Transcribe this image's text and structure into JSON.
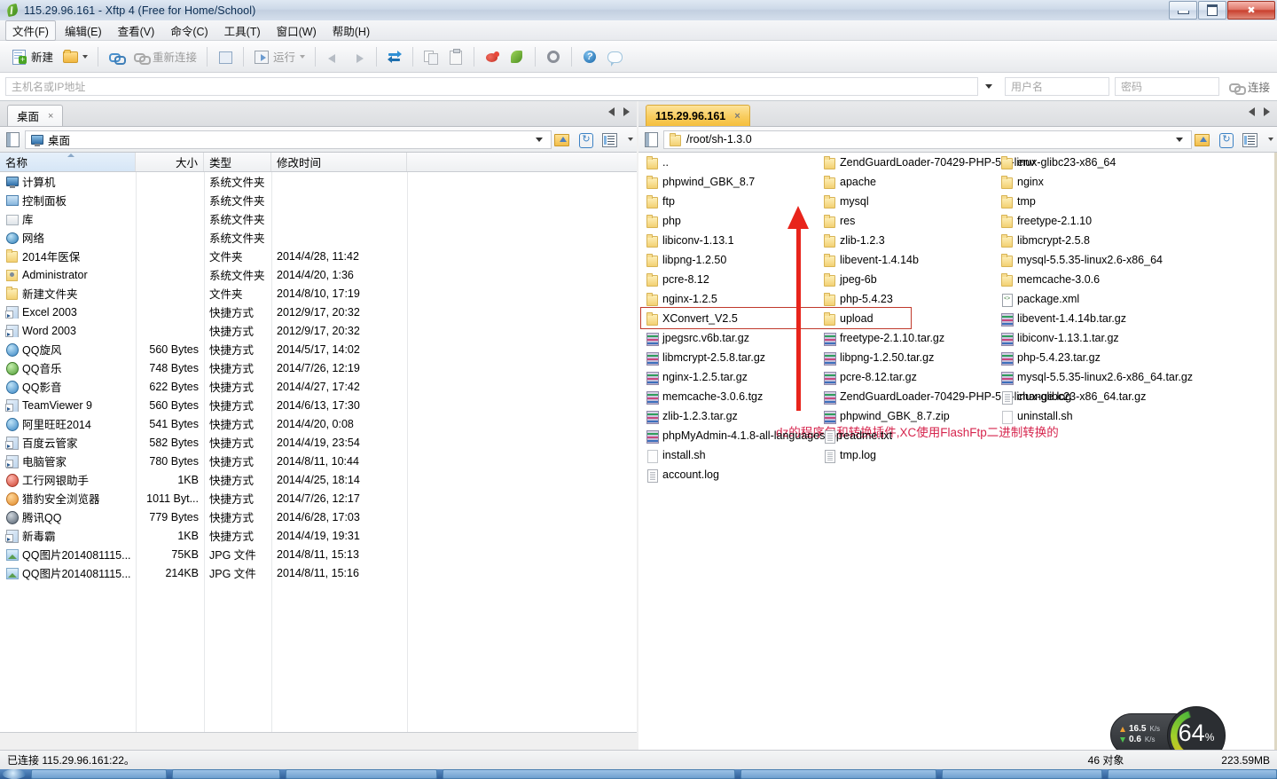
{
  "window": {
    "title": "115.29.96.161 - Xftp 4 (Free for Home/School)",
    "minimize": "—",
    "maximize": "❐",
    "close": "✕"
  },
  "menubar": [
    "文件(F)",
    "编辑(E)",
    "查看(V)",
    "命令(C)",
    "工具(T)",
    "窗口(W)",
    "帮助(H)"
  ],
  "toolbar": {
    "new_label": "新建",
    "reconnect_label": "重新连接",
    "run_label": "运行"
  },
  "connection": {
    "host_placeholder": "主机名或IP地址",
    "user_placeholder": "用户名",
    "password_placeholder": "密码",
    "connect_label": "连接"
  },
  "left_pane": {
    "tab_label": "桌面",
    "tab_close": "×",
    "path": "桌面",
    "columns": [
      "名称",
      "大小",
      "类型",
      "修改时间"
    ],
    "rows": [
      {
        "icon": "pc-icon",
        "name": "计算机",
        "size": "",
        "type": "系统文件夹",
        "mtime": ""
      },
      {
        "icon": "control-panel-icon",
        "name": "控制面板",
        "size": "",
        "type": "系统文件夹",
        "mtime": ""
      },
      {
        "icon": "library-icon",
        "name": "库",
        "size": "",
        "type": "系统文件夹",
        "mtime": ""
      },
      {
        "icon": "network-icon",
        "name": "网络",
        "size": "",
        "type": "系统文件夹",
        "mtime": ""
      },
      {
        "icon": "folder-icon",
        "name": "2014年医保",
        "size": "",
        "type": "文件夹",
        "mtime": "2014/4/28, 11:42"
      },
      {
        "icon": "user-folder-icon",
        "name": "Administrator",
        "size": "",
        "type": "系统文件夹",
        "mtime": "2014/4/20, 1:36"
      },
      {
        "icon": "folder-icon",
        "name": "新建文件夹",
        "size": "",
        "type": "文件夹",
        "mtime": "2014/8/10, 17:19"
      },
      {
        "icon": "shortcut-icon",
        "name": "Excel 2003",
        "size": "",
        "type": "快捷方式",
        "mtime": "2012/9/17, 20:32"
      },
      {
        "icon": "shortcut-icon",
        "name": "Word 2003",
        "size": "",
        "type": "快捷方式",
        "mtime": "2012/9/17, 20:32"
      },
      {
        "icon": "qq-xuanfeng-icon",
        "name": "QQ旋风",
        "size": "560 Bytes",
        "type": "快捷方式",
        "mtime": "2014/5/17, 14:02"
      },
      {
        "icon": "qq-music-icon",
        "name": "QQ音乐",
        "size": "748 Bytes",
        "type": "快捷方式",
        "mtime": "2014/7/26, 12:19"
      },
      {
        "icon": "qq-player-icon",
        "name": "QQ影音",
        "size": "622 Bytes",
        "type": "快捷方式",
        "mtime": "2014/4/27, 17:42"
      },
      {
        "icon": "teamviewer-icon",
        "name": "TeamViewer 9",
        "size": "560 Bytes",
        "type": "快捷方式",
        "mtime": "2014/6/13, 17:30"
      },
      {
        "icon": "aliwangwang-icon",
        "name": "阿里旺旺2014",
        "size": "541 Bytes",
        "type": "快捷方式",
        "mtime": "2014/4/20, 0:08"
      },
      {
        "icon": "baidu-icon",
        "name": "百度云管家",
        "size": "582 Bytes",
        "type": "快捷方式",
        "mtime": "2014/4/19, 23:54"
      },
      {
        "icon": "pcmgr-icon",
        "name": "电脑管家",
        "size": "780 Bytes",
        "type": "快捷方式",
        "mtime": "2014/8/11, 10:44"
      },
      {
        "icon": "icbc-icon",
        "name": "工行网银助手",
        "size": "1KB",
        "type": "快捷方式",
        "mtime": "2014/4/25, 18:14"
      },
      {
        "icon": "cheetah-icon",
        "name": "猎豹安全浏览器",
        "size": "1011 Byt...",
        "type": "快捷方式",
        "mtime": "2014/7/26, 12:17"
      },
      {
        "icon": "tencent-qq-icon",
        "name": "腾讯QQ",
        "size": "779 Bytes",
        "type": "快捷方式",
        "mtime": "2014/6/28, 17:03"
      },
      {
        "icon": "shortcut-icon",
        "name": "新毒霸",
        "size": "1KB",
        "type": "快捷方式",
        "mtime": "2014/4/19, 19:31"
      },
      {
        "icon": "image-icon",
        "name": "QQ图片2014081115...",
        "size": "75KB",
        "type": "JPG 文件",
        "mtime": "2014/8/11, 15:13"
      },
      {
        "icon": "image-icon",
        "name": "QQ图片2014081115...",
        "size": "214KB",
        "type": "JPG 文件",
        "mtime": "2014/8/11, 15:16"
      }
    ]
  },
  "right_pane": {
    "tab_label": "115.29.96.161",
    "tab_close": "×",
    "path": "/root/sh-1.3.0",
    "columns": [
      [
        {
          "icon": "folder-icon",
          "name": ".."
        },
        {
          "icon": "folder-icon",
          "name": "phpwind_GBK_8.7"
        },
        {
          "icon": "folder-icon",
          "name": "ftp"
        },
        {
          "icon": "folder-icon",
          "name": "php"
        },
        {
          "icon": "folder-icon",
          "name": "libiconv-1.13.1"
        },
        {
          "icon": "folder-icon",
          "name": "libpng-1.2.50"
        },
        {
          "icon": "folder-icon",
          "name": "pcre-8.12"
        },
        {
          "icon": "folder-icon",
          "name": "nginx-1.2.5"
        },
        {
          "icon": "folder-icon",
          "name": "XConvert_V2.5"
        },
        {
          "icon": "zip-icon",
          "name": "jpegsrc.v6b.tar.gz"
        },
        {
          "icon": "zip-icon",
          "name": "libmcrypt-2.5.8.tar.gz"
        },
        {
          "icon": "zip-icon",
          "name": "nginx-1.2.5.tar.gz"
        },
        {
          "icon": "zip-icon",
          "name": "memcache-3.0.6.tgz"
        },
        {
          "icon": "zip-icon",
          "name": "zlib-1.2.3.tar.gz"
        },
        {
          "icon": "zip-icon",
          "name": "phpMyAdmin-4.1.8-all-languages.zip"
        },
        {
          "icon": "plain-file-icon",
          "name": "install.sh"
        },
        {
          "icon": "log-file-icon",
          "name": "account.log"
        }
      ],
      [
        {
          "icon": "folder-icon",
          "name": "ZendGuardLoader-70429-PHP-5.4-linux-glibc23-x86_64"
        },
        {
          "icon": "folder-icon",
          "name": "apache"
        },
        {
          "icon": "folder-icon",
          "name": "mysql"
        },
        {
          "icon": "folder-icon",
          "name": "res"
        },
        {
          "icon": "folder-icon",
          "name": "zlib-1.2.3"
        },
        {
          "icon": "folder-icon",
          "name": "libevent-1.4.14b"
        },
        {
          "icon": "folder-icon",
          "name": "jpeg-6b"
        },
        {
          "icon": "folder-icon",
          "name": "php-5.4.23"
        },
        {
          "icon": "folder-icon",
          "name": "upload"
        },
        {
          "icon": "zip-icon",
          "name": "freetype-2.1.10.tar.gz"
        },
        {
          "icon": "zip-icon",
          "name": "libpng-1.2.50.tar.gz"
        },
        {
          "icon": "zip-icon",
          "name": "pcre-8.12.tar.gz"
        },
        {
          "icon": "zip-icon",
          "name": "ZendGuardLoader-70429-PHP-5.4-linux-glibc23-x86_64.tar.gz"
        },
        {
          "icon": "zip-icon",
          "name": "phpwind_GBK_8.7.zip"
        },
        {
          "icon": "log-file-icon",
          "name": "readme.txt"
        },
        {
          "icon": "log-file-icon",
          "name": "tmp.log"
        }
      ],
      [
        {
          "icon": "folder-icon",
          "name": "env"
        },
        {
          "icon": "folder-icon",
          "name": "nginx"
        },
        {
          "icon": "folder-icon",
          "name": "tmp"
        },
        {
          "icon": "folder-icon",
          "name": "freetype-2.1.10"
        },
        {
          "icon": "folder-icon",
          "name": "libmcrypt-2.5.8"
        },
        {
          "icon": "folder-icon",
          "name": "mysql-5.5.35-linux2.6-x86_64"
        },
        {
          "icon": "folder-icon",
          "name": "memcache-3.0.6"
        },
        {
          "icon": "xml-file-icon",
          "name": "package.xml"
        },
        {
          "icon": "zip-icon",
          "name": "libevent-1.4.14b.tar.gz"
        },
        {
          "icon": "zip-icon",
          "name": "libiconv-1.13.1.tar.gz"
        },
        {
          "icon": "zip-icon",
          "name": "php-5.4.23.tar.gz"
        },
        {
          "icon": "zip-icon",
          "name": "mysql-5.5.35-linux2.6-x86_64.tar.gz"
        },
        {
          "icon": "log-file-icon",
          "name": "change.log"
        },
        {
          "icon": "plain-file-icon",
          "name": "uninstall.sh"
        }
      ]
    ]
  },
  "annotation": {
    "text": "dz的程序包和转换插件,XC使用FlashFtp二进制转换的",
    "color": "#d6264e"
  },
  "statusbar": {
    "connected": "已连接 115.29.96.161:22。",
    "objects": "46 对象",
    "size": "223.59MB"
  },
  "speed_widget": {
    "upload": "16.5",
    "upload_unit": "K/s",
    "download": "0.6",
    "download_unit": "K/s",
    "percent": "64",
    "percent_symbol": "%"
  }
}
